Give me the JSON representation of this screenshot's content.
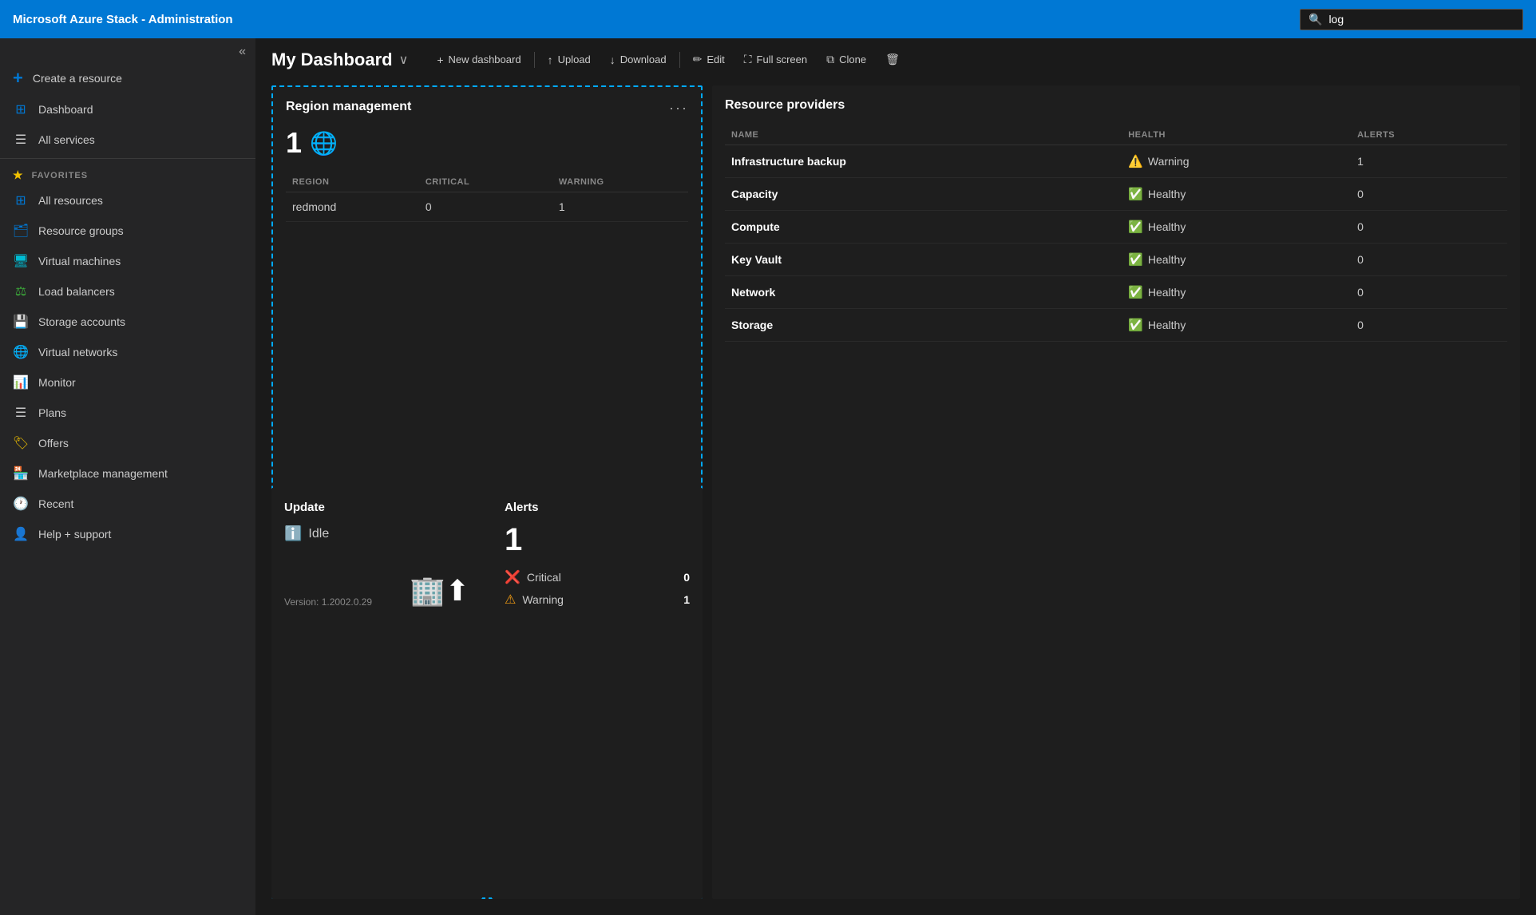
{
  "topbar": {
    "title": "Microsoft Azure Stack - Administration",
    "search_placeholder": "log",
    "search_value": "log"
  },
  "sidebar": {
    "collapse_icon": "«",
    "create_resource_label": "Create a resource",
    "items": [
      {
        "id": "dashboard",
        "label": "Dashboard",
        "icon": "⊞"
      },
      {
        "id": "all-services",
        "label": "All services",
        "icon": "☰"
      }
    ],
    "favorites_label": "FAVORITES",
    "favorites_icon": "★",
    "favorites_items": [
      {
        "id": "all-resources",
        "label": "All resources",
        "icon": "⊞"
      },
      {
        "id": "resource-groups",
        "label": "Resource groups",
        "icon": "🗂"
      },
      {
        "id": "virtual-machines",
        "label": "Virtual machines",
        "icon": "🖥"
      },
      {
        "id": "load-balancers",
        "label": "Load balancers",
        "icon": "⚖"
      },
      {
        "id": "storage-accounts",
        "label": "Storage accounts",
        "icon": "💾"
      },
      {
        "id": "virtual-networks",
        "label": "Virtual networks",
        "icon": "🌐"
      },
      {
        "id": "monitor",
        "label": "Monitor",
        "icon": "📊"
      },
      {
        "id": "plans",
        "label": "Plans",
        "icon": "☰"
      },
      {
        "id": "offers",
        "label": "Offers",
        "icon": "🏷"
      },
      {
        "id": "marketplace-management",
        "label": "Marketplace management",
        "icon": "🏪"
      },
      {
        "id": "recent",
        "label": "Recent",
        "icon": "🕐"
      },
      {
        "id": "help-support",
        "label": "Help + support",
        "icon": "👤"
      }
    ]
  },
  "dashboard": {
    "title": "My Dashboard",
    "chevron": "∨",
    "toolbar": {
      "new_dashboard_icon": "+",
      "new_dashboard_label": "New dashboard",
      "upload_icon": "↑",
      "upload_label": "Upload",
      "download_icon": "↓",
      "download_label": "Download",
      "edit_icon": "✏",
      "edit_label": "Edit",
      "fullscreen_icon": "⛶",
      "fullscreen_label": "Full screen",
      "clone_icon": "⧉",
      "clone_label": "Clone",
      "delete_icon": "🗑"
    }
  },
  "region_management": {
    "title": "Region management",
    "menu_icon": "•••",
    "count": "1",
    "globe_icon": "🌐",
    "columns": {
      "region": "REGION",
      "critical": "CRITICAL",
      "warning": "WARNING"
    },
    "rows": [
      {
        "region": "redmond",
        "critical": "0",
        "warning": "1"
      }
    ]
  },
  "update": {
    "title": "Update",
    "status_icon": "ℹ",
    "status_label": "Idle",
    "version_label": "Version: 1.2002.0.29",
    "graphic": "🏢⬆"
  },
  "alerts": {
    "title": "Alerts",
    "total_count": "1",
    "rows": [
      {
        "icon": "❌",
        "label": "Critical",
        "count": "0",
        "icon_color": "red"
      },
      {
        "icon": "⚠",
        "label": "Warning",
        "count": "1",
        "icon_color": "orange"
      }
    ]
  },
  "resource_providers": {
    "title": "Resource providers",
    "columns": {
      "name": "NAME",
      "health": "HEALTH",
      "alerts": "ALERTS"
    },
    "rows": [
      {
        "name": "Infrastructure backup",
        "health": "Warning",
        "health_icon": "⚠",
        "health_status": "warning",
        "alerts": "1"
      },
      {
        "name": "Capacity",
        "health": "Healthy",
        "health_icon": "✔",
        "health_status": "healthy",
        "alerts": "0"
      },
      {
        "name": "Compute",
        "health": "Healthy",
        "health_icon": "✔",
        "health_status": "healthy",
        "alerts": "0"
      },
      {
        "name": "Key Vault",
        "health": "Healthy",
        "health_icon": "✔",
        "health_status": "healthy",
        "alerts": "0"
      },
      {
        "name": "Network",
        "health": "Healthy",
        "health_icon": "✔",
        "health_status": "healthy",
        "alerts": "0"
      },
      {
        "name": "Storage",
        "health": "Healthy",
        "health_icon": "✔",
        "health_status": "healthy",
        "alerts": "0"
      }
    ]
  }
}
